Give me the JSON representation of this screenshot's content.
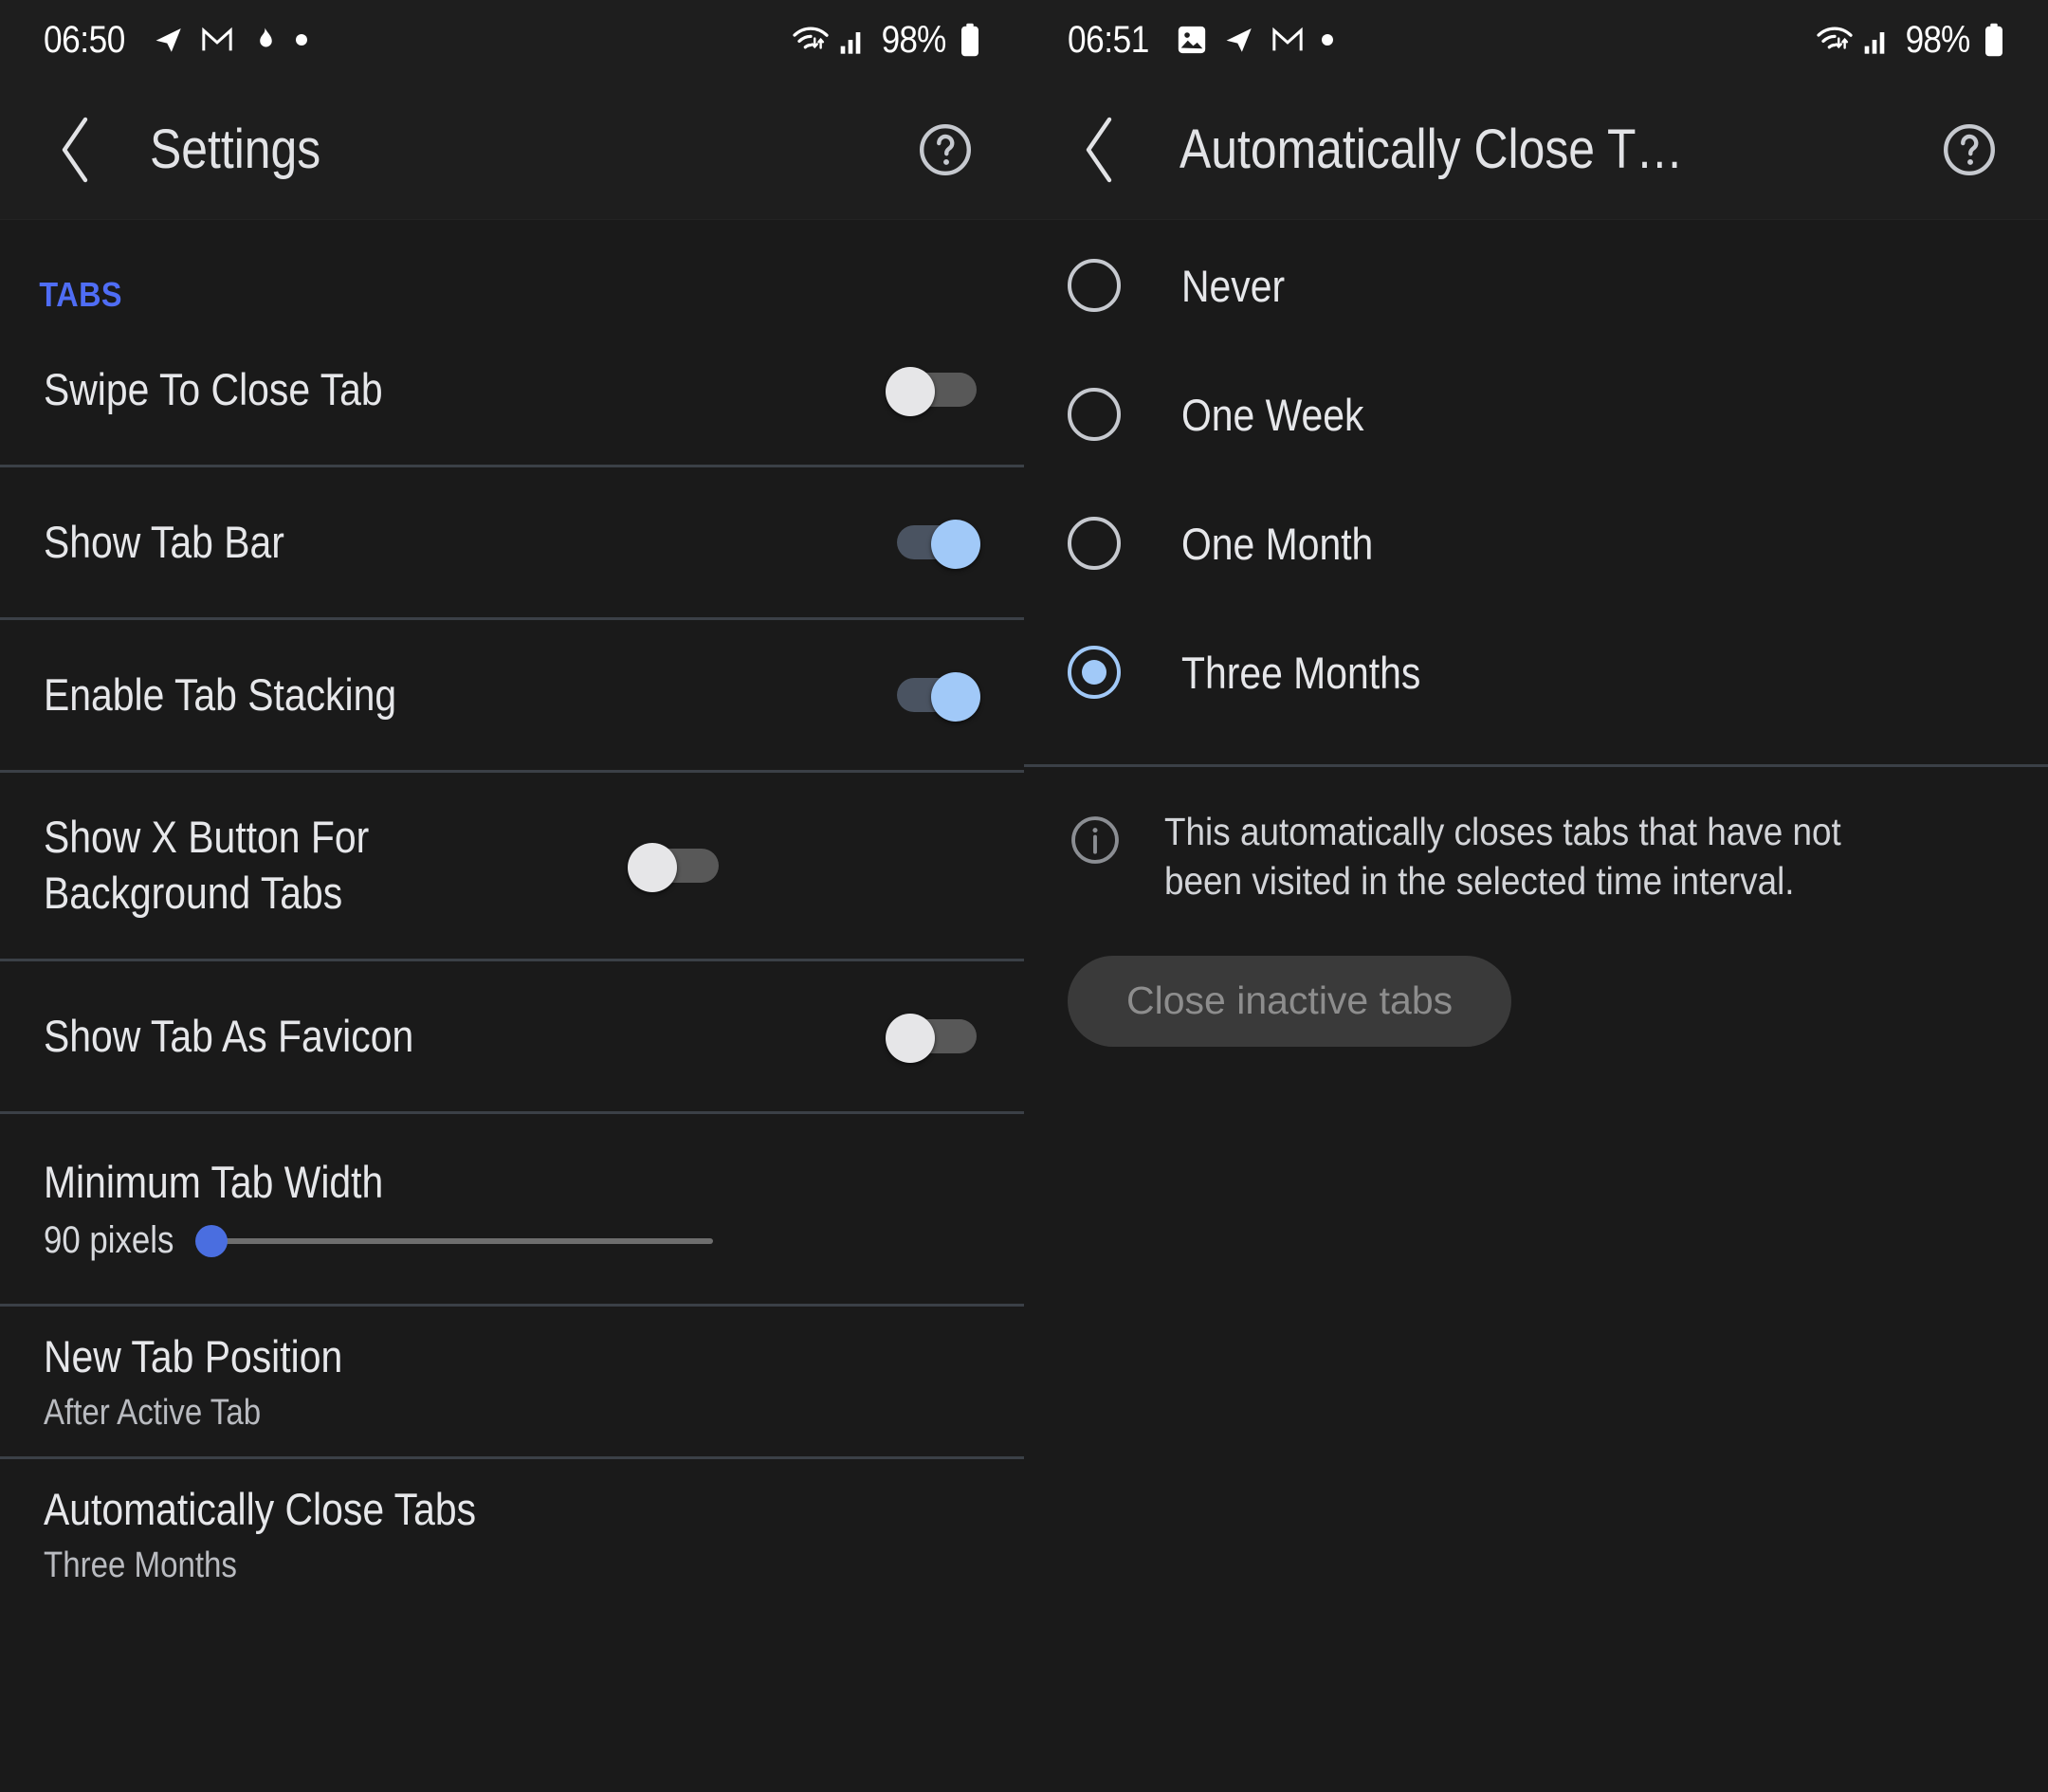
{
  "left": {
    "status_bar": {
      "time": "06:50",
      "battery_percent": "98%",
      "icons": [
        "telegram-icon",
        "gmail-icon",
        "flame-icon",
        "dot-icon"
      ],
      "right_icons": [
        "wifi-icon",
        "signal-icon",
        "battery-icon"
      ]
    },
    "appbar": {
      "back_icon": "chevron-left-icon",
      "title": "Settings",
      "help_icon": "help-circle-icon"
    },
    "section_label": "TABS",
    "rows": [
      {
        "title": "Swipe To Close Tab",
        "control": "toggle",
        "state": "off"
      },
      {
        "title": "Show Tab Bar",
        "control": "toggle",
        "state": "on"
      },
      {
        "title": "Enable Tab Stacking",
        "control": "toggle",
        "state": "on"
      },
      {
        "title": "Show X Button For Background Tabs",
        "control": "toggle",
        "state": "off"
      },
      {
        "title": "Show Tab As Favicon",
        "control": "toggle",
        "state": "off"
      }
    ],
    "slider": {
      "title": "Minimum Tab Width",
      "value_label": "90 pixels",
      "value": 90,
      "position_percent": 0
    },
    "nav_rows": [
      {
        "title": "New Tab Position",
        "sub": "After Active Tab"
      },
      {
        "title": "Automatically Close Tabs",
        "sub": "Three Months"
      }
    ]
  },
  "right": {
    "status_bar": {
      "time": "06:51",
      "battery_percent": "98%",
      "icons": [
        "photo-icon",
        "telegram-icon",
        "gmail-icon",
        "dot-icon"
      ],
      "right_icons": [
        "wifi-icon",
        "signal-icon",
        "battery-icon"
      ]
    },
    "appbar": {
      "back_icon": "chevron-left-icon",
      "title": "Automatically Close T…",
      "help_icon": "help-circle-icon"
    },
    "options": [
      {
        "label": "Never",
        "selected": false
      },
      {
        "label": "One Week",
        "selected": false
      },
      {
        "label": "One Month",
        "selected": false
      },
      {
        "label": "Three Months",
        "selected": true
      }
    ],
    "info": {
      "icon": "info-circle-icon",
      "text": "This automatically closes tabs that have not been visited in the selected time interval."
    },
    "action_button": {
      "label": "Close inactive tabs",
      "enabled": false
    }
  },
  "colors": {
    "background": "#1a1a1a",
    "status_bar_bg": "#1e1e1e",
    "accent_blue": "#4f6df5",
    "toggle_on_thumb": "#a1c9f8",
    "toggle_on_track": "#4a5361",
    "toggle_off_thumb": "#e6e6e8",
    "toggle_off_track": "#585858",
    "slider_thumb": "#4a6ee0",
    "divider": "#3b4047",
    "text_primary": "#e6e7ea",
    "text_secondary": "#b9bbc0",
    "button_bg": "#3a3a3a",
    "button_text": "#8d8d8d"
  }
}
